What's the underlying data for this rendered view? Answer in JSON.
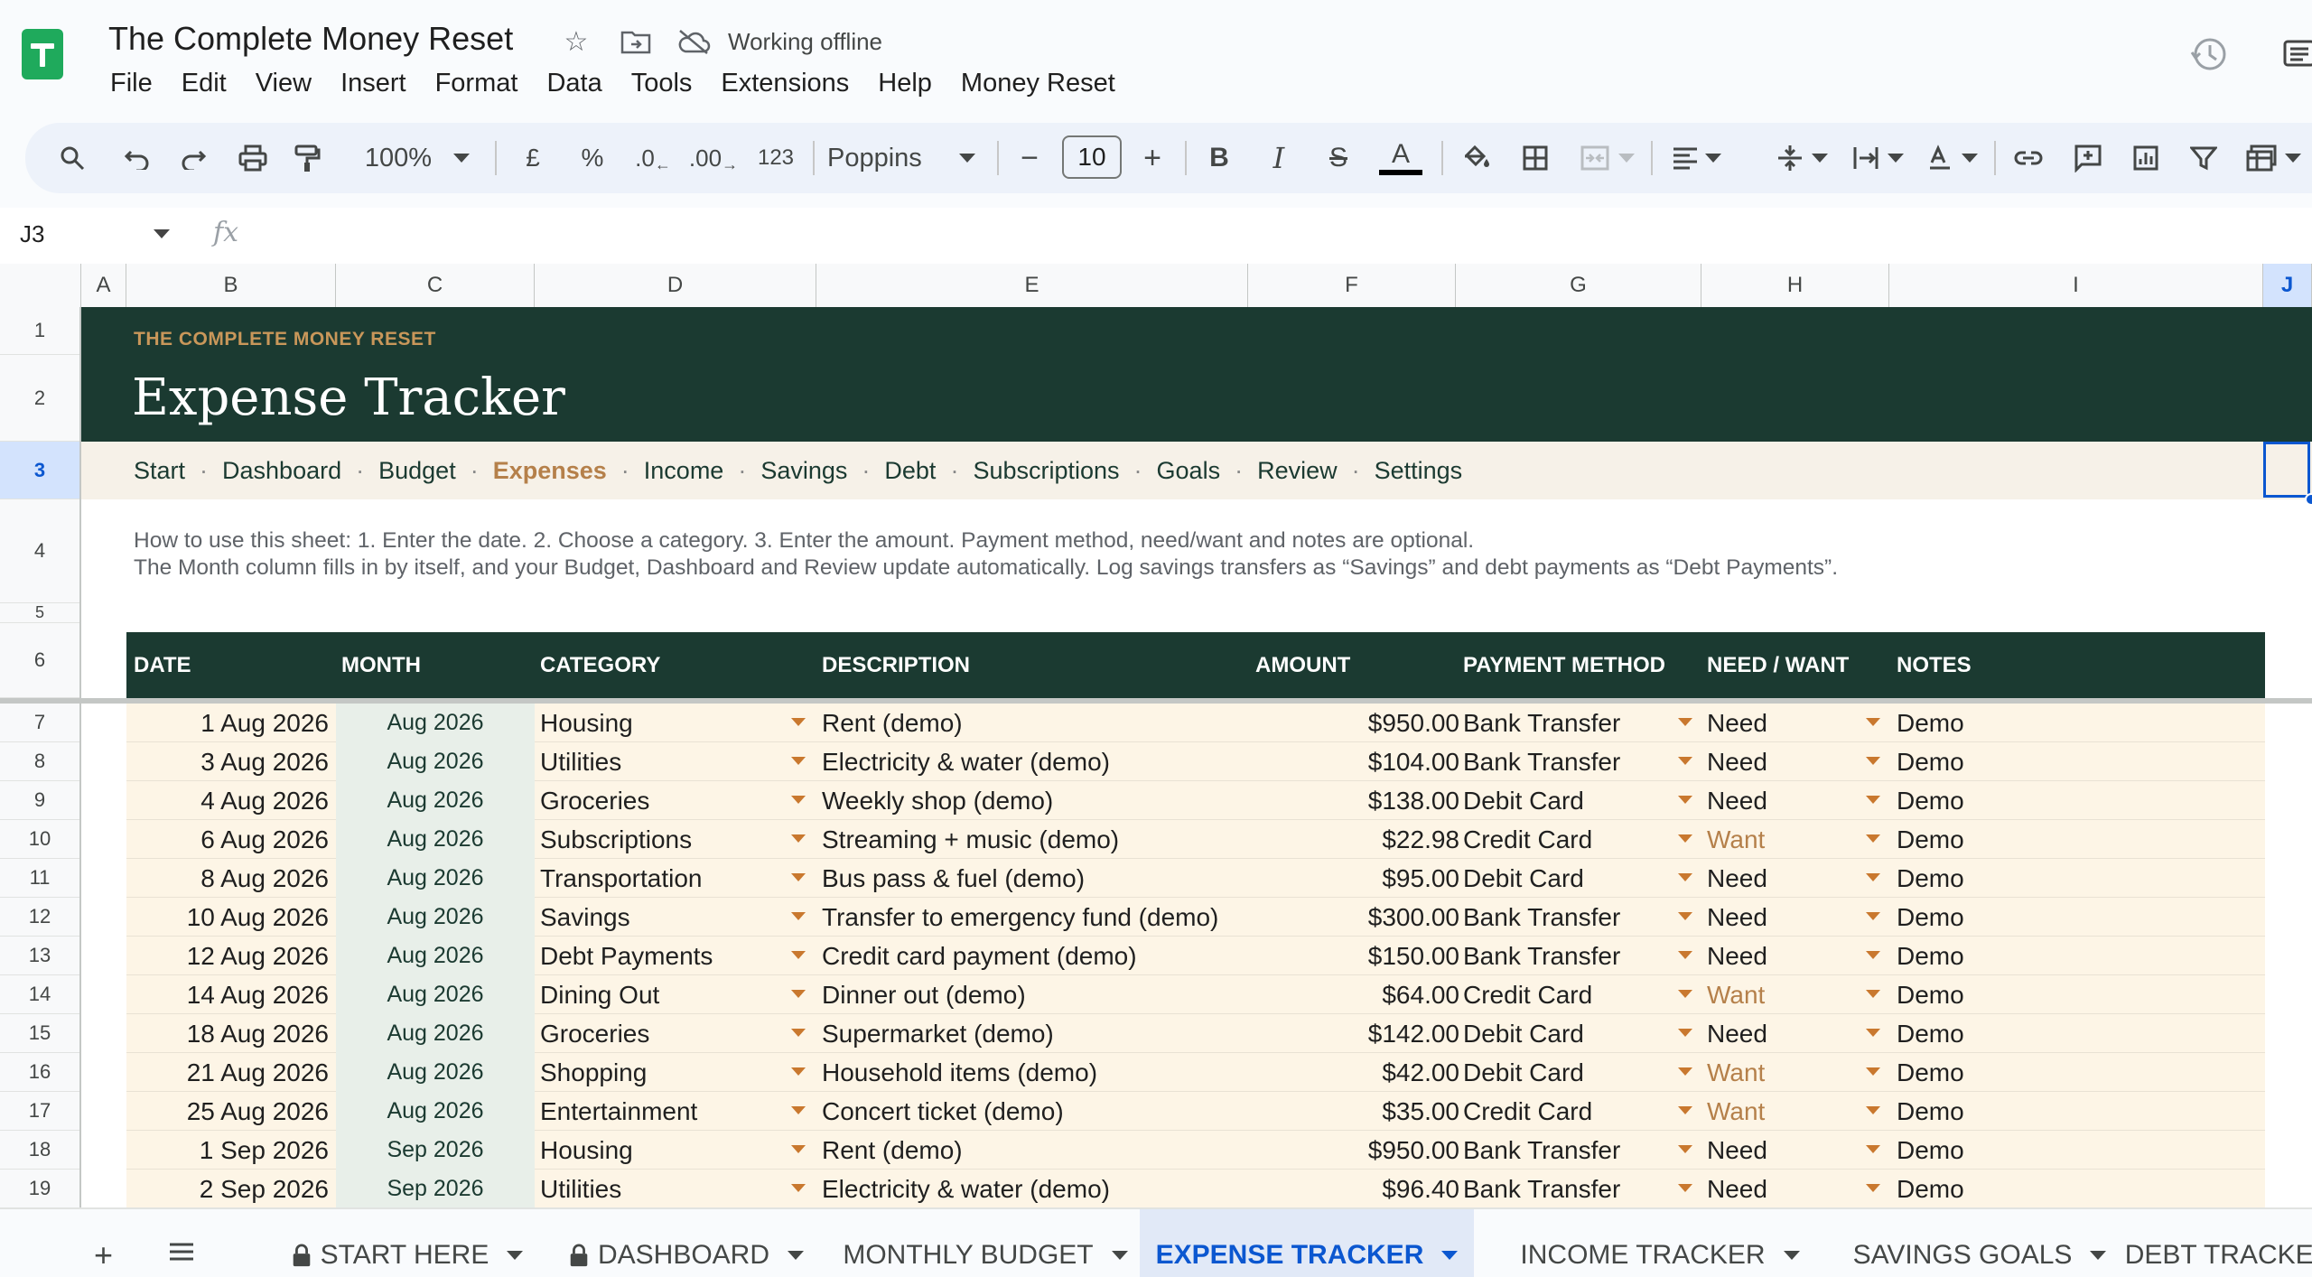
{
  "app": {
    "doc_title": "The Complete Money Reset",
    "offline_label": "Working offline",
    "menu": [
      "File",
      "Edit",
      "View",
      "Insert",
      "Format",
      "Data",
      "Tools",
      "Extensions",
      "Help",
      "Money Reset"
    ]
  },
  "toolbar": {
    "zoom": "100%",
    "currency": "£",
    "percent": "%",
    "decrease_decimal": ".0",
    "increase_decimal": ".00",
    "number_format": "123",
    "font": "Poppins",
    "font_size": "10",
    "bold": "B",
    "italic": "I",
    "strike": "S",
    "text_color": "A"
  },
  "formula_bar": {
    "cell_ref": "J3",
    "fx": "fx",
    "value": ""
  },
  "columns": [
    "A",
    "B",
    "C",
    "D",
    "E",
    "F",
    "G",
    "H",
    "I",
    "J"
  ],
  "rows": [
    "1",
    "2",
    "3",
    "4",
    "5",
    "6",
    "7",
    "8",
    "9",
    "10",
    "11",
    "12",
    "13",
    "14",
    "15",
    "16",
    "17",
    "18",
    "19"
  ],
  "sheet": {
    "kicker": "THE COMPLETE MONEY RESET",
    "title": "Expense Tracker",
    "nav": [
      "Start",
      "Dashboard",
      "Budget",
      "Expenses",
      "Income",
      "Savings",
      "Debt",
      "Subscriptions",
      "Goals",
      "Review",
      "Settings"
    ],
    "nav_active": "Expenses",
    "instructions_line1": "How to use this sheet:  1. Enter the date.  2. Choose a category.  3. Enter the amount.  Payment method, need/want and notes are optional.",
    "instructions_line2": "The Month column fills in by itself, and your Budget, Dashboard and Review update automatically. Log savings transfers as “Savings” and debt payments as “Debt Payments”.",
    "headers": [
      "DATE",
      "MONTH",
      "CATEGORY",
      "DESCRIPTION",
      "AMOUNT",
      "PAYMENT METHOD",
      "NEED / WANT",
      "NOTES"
    ],
    "entries": [
      {
        "date": "1 Aug 2026",
        "month": "Aug 2026",
        "category": "Housing",
        "description": "Rent (demo)",
        "amount": "$950.00",
        "method": "Bank Transfer",
        "need": "Need",
        "notes": "Demo"
      },
      {
        "date": "3 Aug 2026",
        "month": "Aug 2026",
        "category": "Utilities",
        "description": "Electricity & water (demo)",
        "amount": "$104.00",
        "method": "Bank Transfer",
        "need": "Need",
        "notes": "Demo"
      },
      {
        "date": "4 Aug 2026",
        "month": "Aug 2026",
        "category": "Groceries",
        "description": "Weekly shop (demo)",
        "amount": "$138.00",
        "method": "Debit Card",
        "need": "Need",
        "notes": "Demo"
      },
      {
        "date": "6 Aug 2026",
        "month": "Aug 2026",
        "category": "Subscriptions",
        "description": "Streaming + music (demo)",
        "amount": "$22.98",
        "method": "Credit Card",
        "need": "Want",
        "notes": "Demo"
      },
      {
        "date": "8 Aug 2026",
        "month": "Aug 2026",
        "category": "Transportation",
        "description": "Bus pass & fuel (demo)",
        "amount": "$95.00",
        "method": "Debit Card",
        "need": "Need",
        "notes": "Demo"
      },
      {
        "date": "10 Aug 2026",
        "month": "Aug 2026",
        "category": "Savings",
        "description": "Transfer to emergency fund (demo)",
        "amount": "$300.00",
        "method": "Bank Transfer",
        "need": "Need",
        "notes": "Demo"
      },
      {
        "date": "12 Aug 2026",
        "month": "Aug 2026",
        "category": "Debt Payments",
        "description": "Credit card payment (demo)",
        "amount": "$150.00",
        "method": "Bank Transfer",
        "need": "Need",
        "notes": "Demo"
      },
      {
        "date": "14 Aug 2026",
        "month": "Aug 2026",
        "category": "Dining Out",
        "description": "Dinner out (demo)",
        "amount": "$64.00",
        "method": "Credit Card",
        "need": "Want",
        "notes": "Demo"
      },
      {
        "date": "18 Aug 2026",
        "month": "Aug 2026",
        "category": "Groceries",
        "description": "Supermarket (demo)",
        "amount": "$142.00",
        "method": "Debit Card",
        "need": "Need",
        "notes": "Demo"
      },
      {
        "date": "21 Aug 2026",
        "month": "Aug 2026",
        "category": "Shopping",
        "description": "Household items (demo)",
        "amount": "$42.00",
        "method": "Debit Card",
        "need": "Want",
        "notes": "Demo"
      },
      {
        "date": "25 Aug 2026",
        "month": "Aug 2026",
        "category": "Entertainment",
        "description": "Concert ticket (demo)",
        "amount": "$35.00",
        "method": "Credit Card",
        "need": "Want",
        "notes": "Demo"
      },
      {
        "date": "1 Sep 2026",
        "month": "Sep 2026",
        "category": "Housing",
        "description": "Rent (demo)",
        "amount": "$950.00",
        "method": "Bank Transfer",
        "need": "Need",
        "notes": "Demo"
      },
      {
        "date": "2 Sep 2026",
        "month": "Sep 2026",
        "category": "Utilities",
        "description": "Electricity & water (demo)",
        "amount": "$96.40",
        "method": "Bank Transfer",
        "need": "Need",
        "notes": "Demo"
      }
    ]
  },
  "tabs": [
    {
      "label": "START HERE",
      "locked": true,
      "active": false
    },
    {
      "label": "DASHBOARD",
      "locked": true,
      "active": false
    },
    {
      "label": "MONTHLY BUDGET",
      "locked": false,
      "active": false
    },
    {
      "label": "EXPENSE TRACKER",
      "locked": false,
      "active": true
    },
    {
      "label": "INCOME TRACKER",
      "locked": false,
      "active": false
    },
    {
      "label": "SAVINGS GOALS",
      "locked": false,
      "active": false
    },
    {
      "label": "DEBT TRACKER",
      "locked": false,
      "active": false
    }
  ],
  "colors": {
    "banner": "#1b3a31",
    "accent": "#b5804a",
    "row_fill": "#fdf5e6",
    "month_fill": "#e8efe9",
    "selection": "#0b57d0"
  }
}
